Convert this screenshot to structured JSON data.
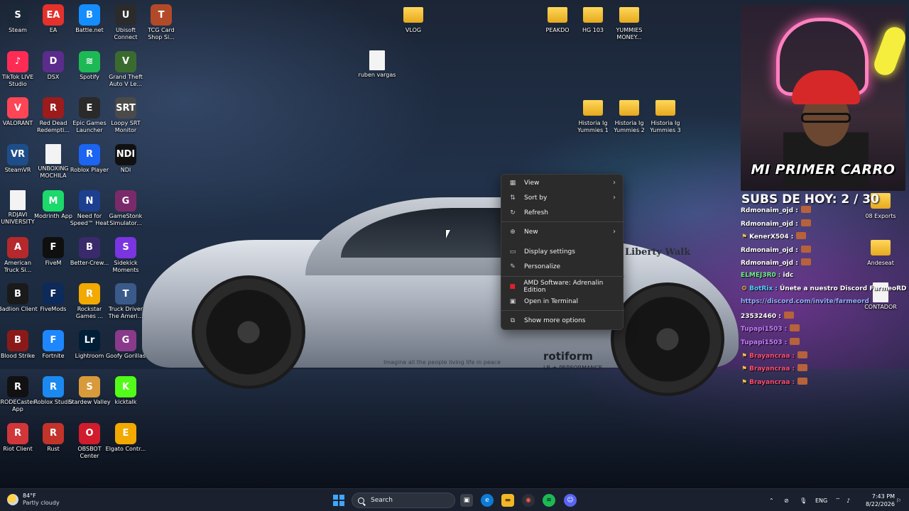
{
  "desktop": {
    "icons": [
      {
        "label": "Steam",
        "color": "#1b2838",
        "glyph": "S"
      },
      {
        "label": "EA",
        "color": "#e4312b",
        "glyph": "EA"
      },
      {
        "label": "Battle.net",
        "color": "#148eff",
        "glyph": "B"
      },
      {
        "label": "Ubisoft Connect",
        "color": "#2b2b2b",
        "glyph": "U"
      },
      {
        "label": "TCG Card Shop Si...",
        "color": "#b24a2a",
        "glyph": "T"
      },
      {
        "label": "TikTok LIVE Studio",
        "color": "#fe2c55",
        "glyph": "♪"
      },
      {
        "label": "DSX",
        "color": "#5b2c8c",
        "glyph": "D"
      },
      {
        "label": "Spotify",
        "color": "#1db954",
        "glyph": "≋"
      },
      {
        "label": "Grand Theft Auto V Le...",
        "color": "#3a6b2e",
        "glyph": "V"
      },
      {
        "label": "VALORANT",
        "color": "#fd4556",
        "glyph": "V"
      },
      {
        "label": "Red Dead Redempti...",
        "color": "#9c1b1b",
        "glyph": "R"
      },
      {
        "label": "Epic Games Launcher",
        "color": "#2a2a2a",
        "glyph": "E"
      },
      {
        "label": "Loopy SRT Monitor",
        "color": "#4a4a4a",
        "glyph": "SRT"
      },
      {
        "label": "SteamVR",
        "color": "#1d4e89",
        "glyph": "VR"
      },
      {
        "label": "UNBOXING MOCHILA",
        "color": "#f3f3f3",
        "glyph": ""
      },
      {
        "label": "Roblox Player",
        "color": "#1c64f2",
        "glyph": "R"
      },
      {
        "label": "NDI",
        "color": "#111111",
        "glyph": "NDI"
      },
      {
        "label": "RDJAVI UNIVERSITY",
        "color": "#f3f3f3",
        "glyph": ""
      },
      {
        "label": "Modrinth App",
        "color": "#1bd96a",
        "glyph": "M"
      },
      {
        "label": "Need for Speed™ Heat",
        "color": "#1d3f8f",
        "glyph": "N"
      },
      {
        "label": "GameStonk Simulator...",
        "color": "#7a2a6a",
        "glyph": "G"
      },
      {
        "label": "American Truck Si...",
        "color": "#b5282b",
        "glyph": "A"
      },
      {
        "label": "FiveM",
        "color": "#0f0f0f",
        "glyph": "F"
      },
      {
        "label": "Better-Crew...",
        "color": "#3a2a6b",
        "glyph": "B"
      },
      {
        "label": "Sidekick Moments",
        "color": "#7a35e0",
        "glyph": "S"
      },
      {
        "label": "Badlion Client",
        "color": "#1a1a1a",
        "glyph": "B"
      },
      {
        "label": "FiveMods",
        "color": "#0c2a5a",
        "glyph": "F"
      },
      {
        "label": "Rockstar Games ...",
        "color": "#f2a900",
        "glyph": "R"
      },
      {
        "label": "Truck Driver The Ameri...",
        "color": "#3a5a8a",
        "glyph": "T"
      },
      {
        "label": "Blood Strike",
        "color": "#8a1a1a",
        "glyph": "B"
      },
      {
        "label": "Fortnite",
        "color": "#1e87ff",
        "glyph": "F"
      },
      {
        "label": "Lightroom",
        "color": "#001e36",
        "glyph": "Lr"
      },
      {
        "label": "Goofy Gorillas",
        "color": "#8a3a8a",
        "glyph": "G"
      },
      {
        "label": "RODECaster App",
        "color": "#111111",
        "glyph": "R"
      },
      {
        "label": "Roblox Studio",
        "color": "#1b8af0",
        "glyph": "R"
      },
      {
        "label": "Stardew Valley",
        "color": "#d89a3a",
        "glyph": "S"
      },
      {
        "label": "kicktalk",
        "color": "#53fc18",
        "glyph": "K"
      },
      {
        "label": "Riot Client",
        "color": "#d13639",
        "glyph": "R"
      },
      {
        "label": "Rust",
        "color": "#c2332a",
        "glyph": "R"
      },
      {
        "label": "OBSBOT Center",
        "color": "#d01c2c",
        "glyph": "O"
      },
      {
        "label": "Elgato Contr...",
        "color": "#f2a900",
        "glyph": "E"
      }
    ],
    "extra_icons": [
      {
        "label": "VLOG",
        "type": "folder"
      },
      {
        "label": "ruben vargas",
        "type": "doc"
      },
      {
        "label": "PEAKDO",
        "type": "folder"
      },
      {
        "label": "HG 103",
        "type": "folder"
      },
      {
        "label": "YUMMIES MONEY...",
        "type": "folder"
      },
      {
        "label": "Historia Ig Yummies 1",
        "type": "folder"
      },
      {
        "label": "Historia Ig Yummies 2",
        "type": "folder"
      },
      {
        "label": "Historia Ig Yummies 3",
        "type": "folder"
      },
      {
        "label": "08 Exports",
        "type": "folder"
      },
      {
        "label": "Andeseat",
        "type": "folder"
      },
      {
        "label": "CONTADOR",
        "type": "doc"
      }
    ]
  },
  "wallpaper": {
    "brand": "Liberty Walk",
    "tagline": "Imagine all the people living life in peace",
    "rotiform": "rotiform",
    "lbperf": "LB ★ PERFORMANCE"
  },
  "context_menu": {
    "items": [
      {
        "label": "View",
        "icon": "grid-icon",
        "glyph": "▦",
        "submenu": true
      },
      {
        "label": "Sort by",
        "icon": "sort-icon",
        "glyph": "⇅",
        "submenu": true
      },
      {
        "label": "Refresh",
        "icon": "refresh-icon",
        "glyph": "↻",
        "submenu": false
      },
      {
        "label": "New",
        "icon": "plus-circle-icon",
        "glyph": "⊕",
        "submenu": true
      },
      {
        "label": "Display settings",
        "icon": "display-icon",
        "glyph": "▭",
        "submenu": false
      },
      {
        "label": "Personalize",
        "icon": "brush-icon",
        "glyph": "✎",
        "submenu": false
      },
      {
        "label": "AMD Software: Adrenalin Edition",
        "icon": "amd-icon",
        "glyph": "■",
        "submenu": false
      },
      {
        "label": "Open in Terminal",
        "icon": "terminal-icon",
        "glyph": "▣",
        "submenu": false
      },
      {
        "label": "Show more options",
        "icon": "more-options-icon",
        "glyph": "⧉",
        "submenu": false
      }
    ]
  },
  "stream": {
    "headline": "MI PRIMER CARRO",
    "subs": "SUBS DE HOY: 2 / 30",
    "chat": [
      {
        "user": "Rdmonaim_ojd :",
        "msg": "",
        "emote": true,
        "color": "#ffffff",
        "badge": ""
      },
      {
        "user": "Rdmonaim_ojd :",
        "msg": "",
        "emote": true,
        "color": "#ffffff",
        "badge": ""
      },
      {
        "user": "KenerX504 :",
        "msg": "",
        "emote": true,
        "color": "#ffffff",
        "badge": "⚑"
      },
      {
        "user": "Rdmonaim_ojd :",
        "msg": "",
        "emote": true,
        "color": "#ffffff",
        "badge": ""
      },
      {
        "user": "Rdmonaim_ojd :",
        "msg": "",
        "emote": true,
        "color": "#ffffff",
        "badge": ""
      },
      {
        "user": "ELMEJ3R0 :",
        "msg": "idc",
        "emote": false,
        "color": "#6ef08a",
        "badge": ""
      },
      {
        "user": "BotRix :",
        "msg": "Únete a nuestro Discord FarmeoRD",
        "emote": false,
        "color": "#4fd0ff",
        "badge": "⚙"
      },
      {
        "user": "",
        "msg": "https://discord.com/invite/farmeord",
        "emote": false,
        "color": "#8fb1ff",
        "badge": ""
      },
      {
        "user": "23532460 :",
        "msg": "",
        "emote": true,
        "color": "#ffffff",
        "badge": ""
      },
      {
        "user": "Tupapi1503 :",
        "msg": "",
        "emote": true,
        "color": "#c77dff",
        "badge": ""
      },
      {
        "user": "Tupapi1503 :",
        "msg": "",
        "emote": true,
        "color": "#c77dff",
        "badge": ""
      },
      {
        "user": "Brayancraa :",
        "msg": "",
        "emote": true,
        "color": "#ff4d6d",
        "badge": "⚑"
      },
      {
        "user": "Brayancraa :",
        "msg": "",
        "emote": true,
        "color": "#ff4d6d",
        "badge": "⚑"
      },
      {
        "user": "Brayancraa :",
        "msg": "",
        "emote": true,
        "color": "#ff4d6d",
        "badge": "⚑"
      }
    ]
  },
  "taskbar": {
    "weather_temp": "84°F",
    "weather_desc": "Partly cloudy",
    "search_label": "Search",
    "language": "ENG",
    "time": "7:43 PM",
    "date": "8/22/2026"
  }
}
